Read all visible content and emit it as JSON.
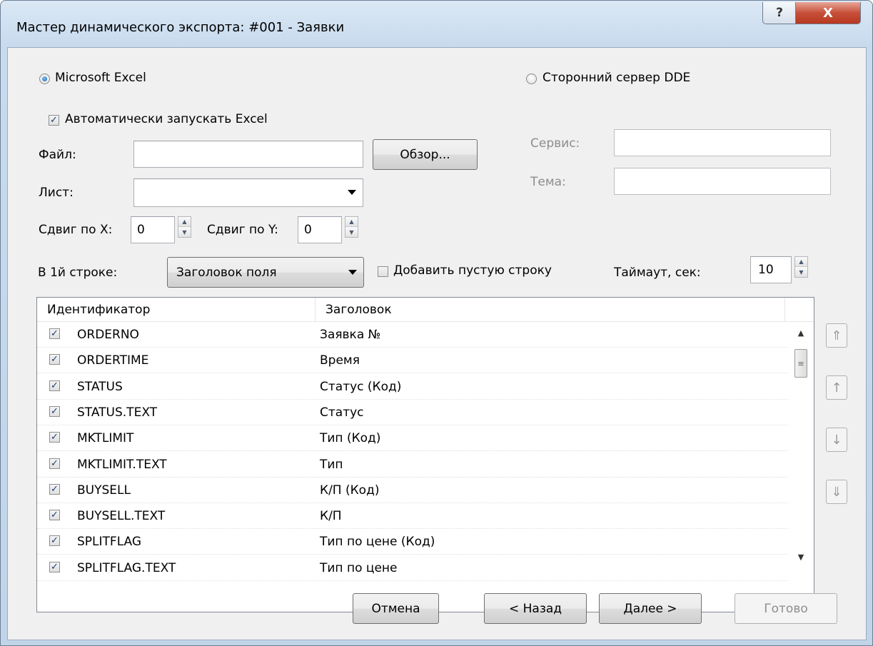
{
  "window": {
    "title": "Мастер динамического экспорта: #001 - Заявки",
    "help": "?",
    "close": "X"
  },
  "target": {
    "excel_label": "Microsoft Excel",
    "dde_label": "Сторонний сервер DDE",
    "selected": "Microsoft Excel"
  },
  "excel": {
    "autostart_label": "Автоматически запускать Excel",
    "autostart_checked": true,
    "file_label": "Файл:",
    "file_value": "",
    "browse_label": "Обзор...",
    "sheet_label": "Лист:",
    "sheet_value": "",
    "offset_x_label": "Сдвиг по X:",
    "offset_x_value": "0",
    "offset_y_label": "Сдвиг по Y:",
    "offset_y_value": "0"
  },
  "dde": {
    "service_label": "Сервис:",
    "service_value": "",
    "topic_label": "Тема:",
    "topic_value": ""
  },
  "options": {
    "first_row_label": "В 1й строке:",
    "first_row_value": "Заголовок поля",
    "add_empty_row_label": "Добавить пустую строку",
    "add_empty_row_checked": false,
    "timeout_label": "Таймаут, сек:",
    "timeout_value": "10"
  },
  "fields": {
    "columns": [
      "Идентификатор",
      "Заголовок"
    ],
    "rows": [
      {
        "id": "ORDERNO",
        "title": "Заявка №",
        "checked": true
      },
      {
        "id": "ORDERTIME",
        "title": "Время",
        "checked": true
      },
      {
        "id": "STATUS",
        "title": "Статус (Код)",
        "checked": true
      },
      {
        "id": "STATUS.TEXT",
        "title": "Статус",
        "checked": true
      },
      {
        "id": "MKTLIMIT",
        "title": "Тип (Код)",
        "checked": true
      },
      {
        "id": "MKTLIMIT.TEXT",
        "title": "Тип",
        "checked": true
      },
      {
        "id": "BUYSELL",
        "title": "К/П (Код)",
        "checked": true
      },
      {
        "id": "BUYSELL.TEXT",
        "title": "К/П",
        "checked": true
      },
      {
        "id": "SPLITFLAG",
        "title": "Тип по цене (Код)",
        "checked": true
      },
      {
        "id": "SPLITFLAG.TEXT",
        "title": "Тип по цене",
        "checked": true
      }
    ]
  },
  "side_buttons": {
    "top": "⇑",
    "up": "↑",
    "down": "↓",
    "bottom": "⇓"
  },
  "footer": {
    "cancel": "Отмена",
    "back": "< Назад",
    "next": "Далее >",
    "finish": "Готово"
  },
  "icons": {
    "check": "✓",
    "scroll_up": "▲",
    "scroll_down": "▼",
    "grip": "≡"
  }
}
